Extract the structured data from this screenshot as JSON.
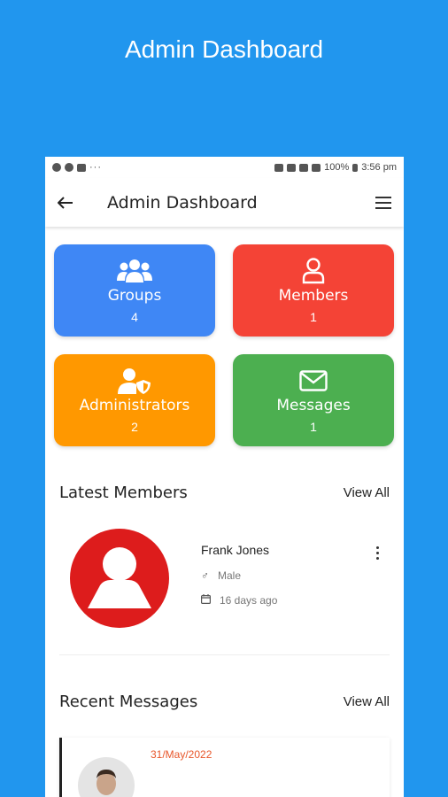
{
  "promo": {
    "title": "Admin Dashboard"
  },
  "statusbar": {
    "battery": "100%",
    "time": "3:56 pm"
  },
  "appbar": {
    "title": "Admin Dashboard",
    "back_icon": "arrow-left-icon",
    "menu_icon": "hamburger-icon"
  },
  "cards": [
    {
      "label": "Groups",
      "count": "4",
      "color": "#3F87F5",
      "icon": "users-icon"
    },
    {
      "label": "Members",
      "count": "1",
      "color": "#F44336",
      "icon": "user-icon"
    },
    {
      "label": "Administrators",
      "count": "2",
      "color": "#FF9800",
      "icon": "user-shield-icon"
    },
    {
      "label": "Messages",
      "count": "1",
      "color": "#4CAF50",
      "icon": "envelope-icon"
    }
  ],
  "latest_members": {
    "heading": "Latest Members",
    "view_all": "View All",
    "member": {
      "name": "Frank Jones",
      "gender": "Male",
      "joined": "16 days ago"
    }
  },
  "recent_messages": {
    "heading": "Recent Messages",
    "view_all": "View All",
    "message": {
      "date": "31/May/2022"
    }
  }
}
